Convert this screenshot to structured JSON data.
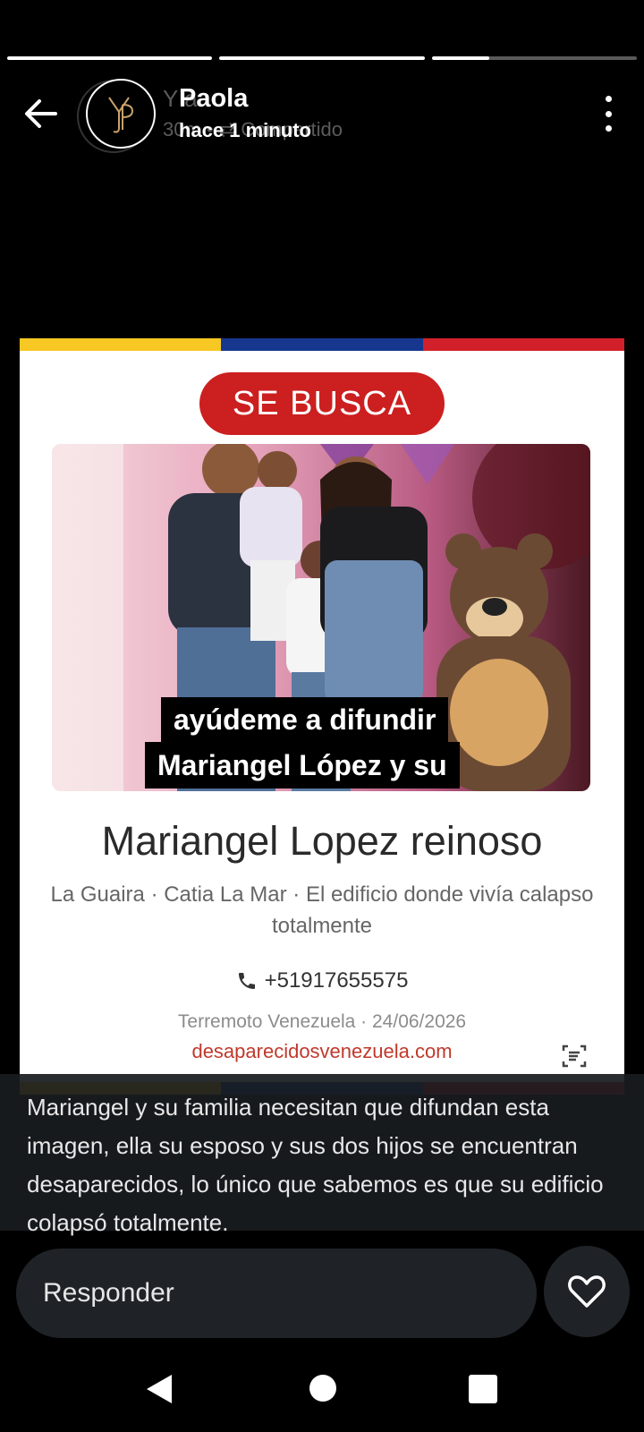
{
  "story": {
    "segments_progress": [
      1.0,
      1.0,
      0.28
    ]
  },
  "header": {
    "user_name": "Paola",
    "time_ago": "hace 1 minuto",
    "ghost_name": "Y   a",
    "ghost_meta": "30m • ⇄ Compartido",
    "icons": {
      "back": "arrow-left-icon",
      "more": "more-vertical-icon",
      "avatar": "monogram-logo"
    }
  },
  "poster": {
    "badge": "SE BUSCA",
    "photo_caption_line1": "ayúdeme a difundir",
    "photo_caption_line2": "Mariangel López y su",
    "name": "Mariangel Lopez reinoso",
    "location": "La Guaira · Catia La Mar · El edificio  donde vivía calapso totalmente",
    "phone": "+51917655575",
    "event": "Terremoto  Venezuela · 24/06/2026",
    "website": "desaparecidosvenezuela.com",
    "flag_colors": [
      "#f7c823",
      "#17378f",
      "#d2202a"
    ]
  },
  "caption": {
    "text": "Mariangel y su familia necesitan que difundan esta imagen, ella su esposo y sus dos hijos se encuentran desaparecidos, lo único que sabemos es que su edificio colapsó totalmente."
  },
  "reply": {
    "placeholder": "Responder"
  },
  "navbar": {
    "icons": [
      "nav-back-icon",
      "nav-home-icon",
      "nav-recents-icon"
    ]
  }
}
